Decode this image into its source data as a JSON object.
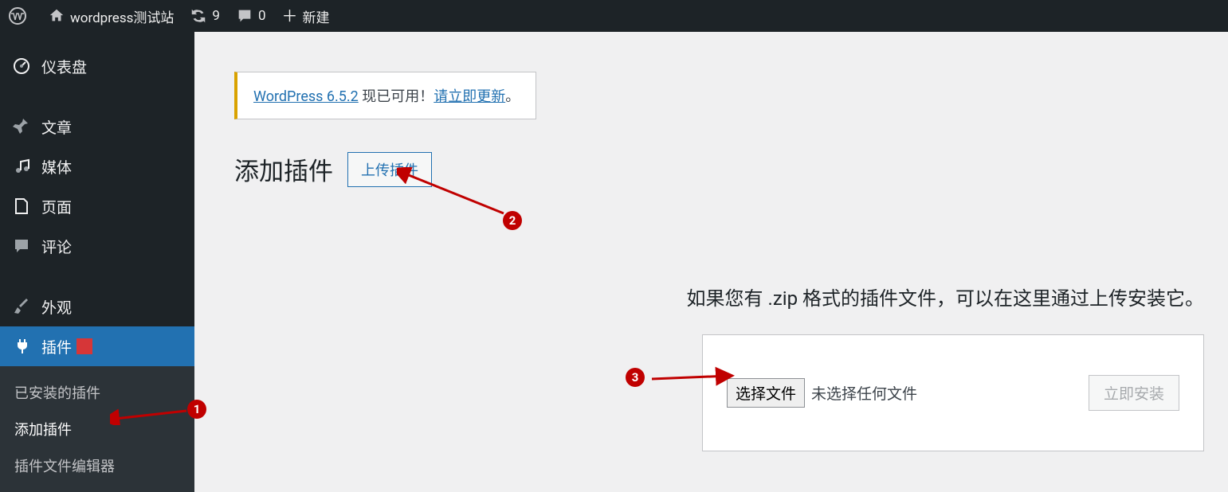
{
  "adminbar": {
    "site_name": "wordpress测试站",
    "updates_count": "9",
    "comments_count": "0",
    "new_label": "新建"
  },
  "sidebar": {
    "items": [
      {
        "id": "dashboard",
        "label": "仪表盘"
      },
      {
        "id": "posts",
        "label": "文章"
      },
      {
        "id": "media",
        "label": "媒体"
      },
      {
        "id": "pages",
        "label": "页面"
      },
      {
        "id": "comments",
        "label": "评论"
      },
      {
        "id": "appearance",
        "label": "外观"
      },
      {
        "id": "plugins",
        "label": "插件"
      }
    ],
    "plugins_submenu": [
      {
        "id": "installed",
        "label": "已安装的插件"
      },
      {
        "id": "add",
        "label": "添加插件"
      },
      {
        "id": "editor",
        "label": "插件文件编辑器"
      }
    ]
  },
  "notice": {
    "prefix_link": "WordPress 6.5.2",
    "mid_text": " 现已可用！",
    "action_link": "请立即更新",
    "suffix": "。"
  },
  "main": {
    "page_title": "添加插件",
    "upload_button": "上传插件",
    "upload_help": "如果您有 .zip 格式的插件文件，可以在这里通过上传安装它。",
    "file_button": "选择文件",
    "file_status": "未选择任何文件",
    "install_button": "立即安装"
  },
  "annotations": {
    "b1": "1",
    "b2": "2",
    "b3": "3"
  }
}
